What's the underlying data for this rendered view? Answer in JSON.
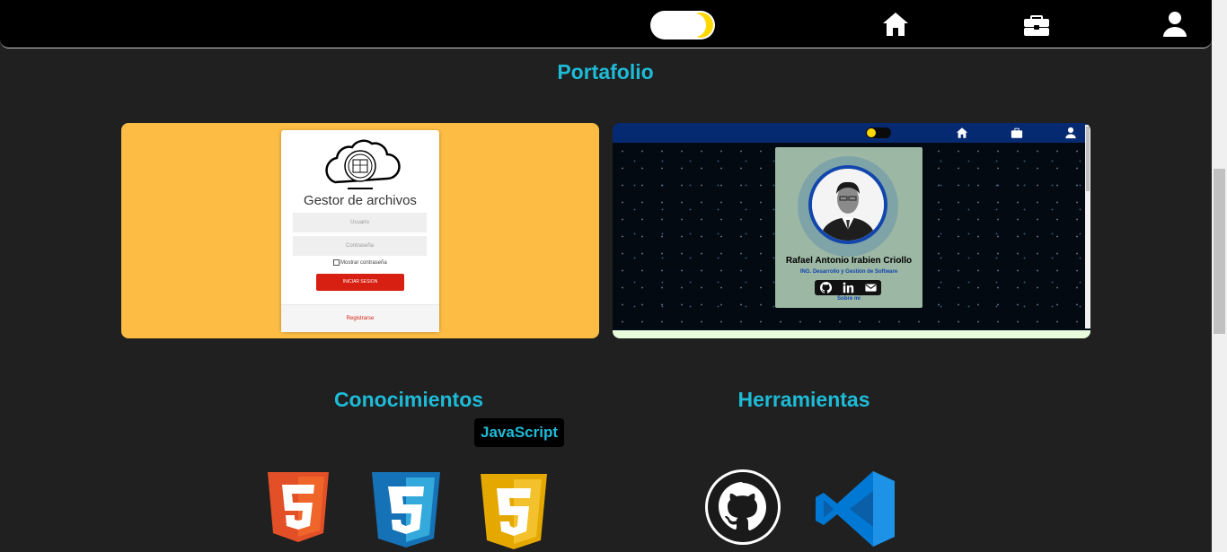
{
  "nav": {
    "theme_toggle": "theme-toggle",
    "icons": [
      "home-icon",
      "briefcase-icon",
      "user-icon"
    ],
    "bar_color": "#000000",
    "toggle_knob_color": "#ffd800"
  },
  "sections": {
    "portfolio": "Portafolio",
    "knowledge": "Conocimientos",
    "tools": "Herramientas"
  },
  "accent_color": "#1ebbd7",
  "projects": [
    {
      "name": "file-manager",
      "background": "#fdbd44",
      "screen": {
        "title": "Gestor de archivos",
        "username_placeholder": "Usuario",
        "password_placeholder": "Contraseña",
        "show_password": "Mostrar contraseña",
        "login_button": "INICIAR SESION",
        "register_link": "Registrarse"
      }
    },
    {
      "name": "personal-portfolio",
      "screen": {
        "person_name": "Rafael Antonio Irabien Criollo",
        "role": "ING. Desarrollo y Gestión de Software",
        "about_link": "Sobre mi",
        "social_icons": [
          "github-icon",
          "linkedin-icon",
          "mail-icon"
        ]
      }
    }
  ],
  "knowledge_tooltip": "JavaScript",
  "knowledge_icons": [
    "html5-icon",
    "css3-icon",
    "javascript-icon"
  ],
  "tool_icons": [
    "github-icon",
    "vscode-icon"
  ]
}
